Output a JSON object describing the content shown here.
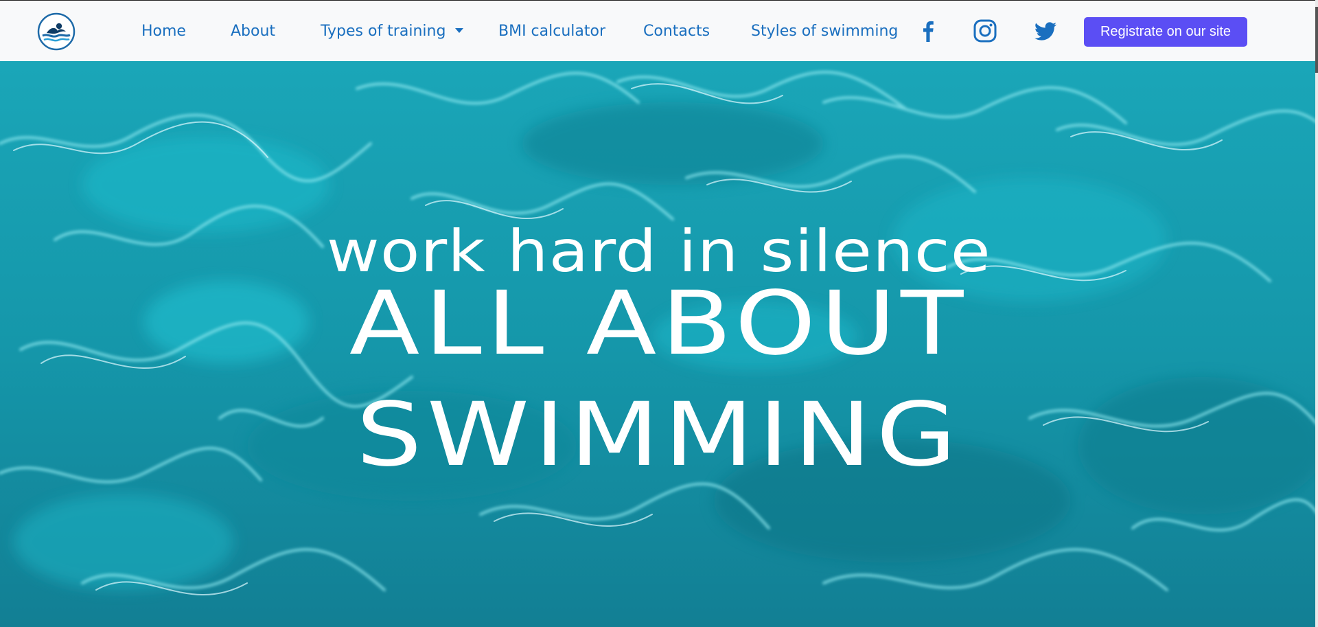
{
  "nav": {
    "logo": {
      "icon": "swimmer-wave-logo-icon"
    },
    "links": [
      {
        "label": "Home"
      },
      {
        "label": "About"
      },
      {
        "label": "Types of training",
        "has_dropdown": true
      },
      {
        "label": "BMI calculator"
      },
      {
        "label": "Contacts"
      },
      {
        "label": "Styles of swimming"
      }
    ],
    "social": [
      "facebook-icon",
      "instagram-icon",
      "twitter-icon"
    ],
    "cta_label": "Registrate on our site"
  },
  "hero": {
    "subtitle": "work hard in silence",
    "title_line1": "ALL ABOUT",
    "title_line2": "SWIMMING"
  },
  "colors": {
    "nav_bg": "#f8f9fa",
    "nav_link": "#1a6fbf",
    "cta_bg": "#5b4ef4",
    "water": "#16a3b4",
    "hero_text": "#ffffff"
  }
}
